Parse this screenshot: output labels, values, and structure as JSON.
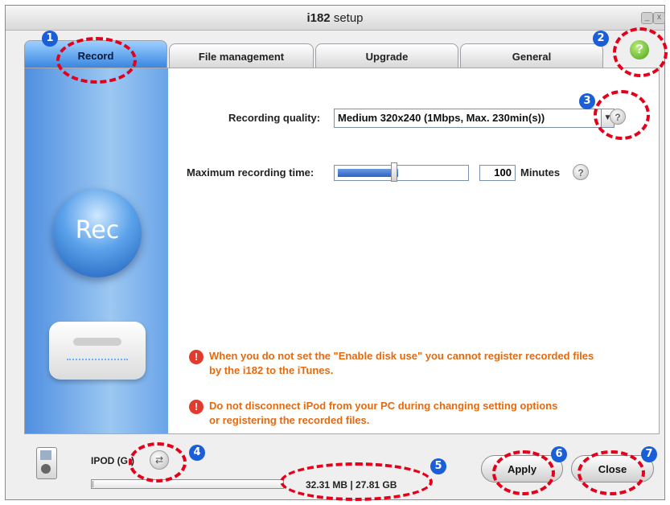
{
  "window": {
    "title_prefix": "i182",
    "title_suffix": " setup",
    "minimize_symbol": "_",
    "close_symbol": "x"
  },
  "tabs": [
    {
      "label": "Record",
      "active": true
    },
    {
      "label": "File management",
      "active": false
    },
    {
      "label": "Upgrade",
      "active": false
    },
    {
      "label": "General",
      "active": false
    }
  ],
  "help": {
    "symbol": "?"
  },
  "left_panel": {
    "rec_text": "Rec"
  },
  "record": {
    "quality_label": "Recording quality:",
    "quality_value": "Medium 320x240 (1Mbps, Max. 230min(s))",
    "max_time_label": "Maximum recording time:",
    "max_time_value": "100",
    "max_time_unit": "Minutes",
    "slider_level_fraction": 0.47
  },
  "warnings": [
    {
      "icon": "!",
      "line1": "When you do not set the \"Enable disk use\" you cannot register recorded files",
      "line2": "by the i182 to the iTunes."
    },
    {
      "icon": "!",
      "line1": "Do not disconnect iPod from your PC during changing setting options",
      "line2": "or registering the recorded files."
    }
  ],
  "footer": {
    "device_label": "IPOD (G:)",
    "storage_text": "32.31 MB | 27.81 GB",
    "storage_used_fraction": 0.0012,
    "apply_label": "Apply",
    "close_label": "Close"
  },
  "callouts": [
    "1",
    "2",
    "3",
    "4",
    "5",
    "6",
    "7"
  ],
  "colors": {
    "callout_badge": "#1b5fd8",
    "callout_ring": "#e4001b",
    "warning_text": "#e46a10",
    "warning_icon": "#e23b2e",
    "active_tab": "#3a86e0"
  },
  "icons": {
    "help": "question-icon",
    "sync": "sync-icon",
    "device": "ipod-icon",
    "warning": "exclamation-icon"
  }
}
